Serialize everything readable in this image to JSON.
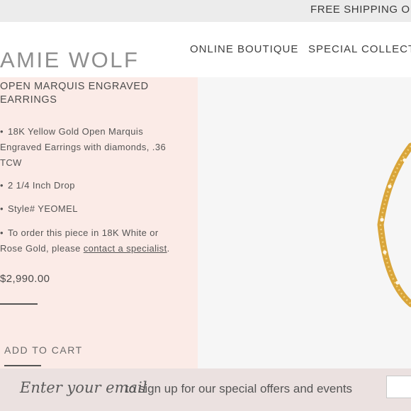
{
  "promo": {
    "text": "FREE SHIPPING ON U"
  },
  "header": {
    "logo": "AMIE WOLF",
    "nav": [
      {
        "label": "ONLINE BOUTIQUE"
      },
      {
        "label": "SPECIAL COLLECT"
      }
    ]
  },
  "product": {
    "title": "OPEN MARQUIS ENGRAVED EARRINGS",
    "bullets": {
      "description": "18K Yellow Gold Open Marquis Engraved Earrings with diamonds, .36 TCW",
      "drop": "2 1/4 Inch Drop",
      "style": "Style# YEOMEL",
      "order_prefix": "To order this piece in 18K White or Rose Gold, please ",
      "order_link": "contact a specialist",
      "order_suffix": "."
    },
    "bullet_glyph": "•",
    "price": "$2,990.00",
    "add_to_cart": "ADD TO CART"
  },
  "signup": {
    "script": "Enter your email",
    "text": "to sign up for our special offers and events",
    "email_placeholder": ""
  },
  "colors": {
    "panel_pink": "#fbebe7",
    "signup_bg": "#ebe1e0",
    "gold": "#d9a53a"
  }
}
